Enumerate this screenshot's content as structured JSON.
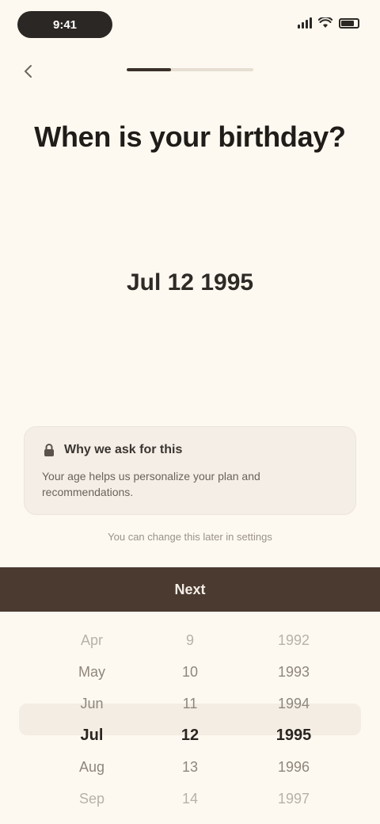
{
  "status_bar": {
    "time": "9:41"
  },
  "progress": {
    "fraction": 0.35
  },
  "question": {
    "title": "When is your birthday?"
  },
  "selected_date": "Jul 12 1995",
  "info_card": {
    "title": "Why we ask for this",
    "body": "Your age helps us personalize your plan and recommendations."
  },
  "hint": "You can change this later in settings",
  "next_button": {
    "label": "Next"
  },
  "picker": {
    "months": [
      "Apr",
      "May",
      "Jun",
      "Jul",
      "Aug",
      "Sep"
    ],
    "days": [
      "9",
      "10",
      "11",
      "12",
      "13",
      "14"
    ],
    "years": [
      "1992",
      "1993",
      "1994",
      "1995",
      "1996",
      "1997"
    ]
  },
  "colors": {
    "background": "#fdf9f0",
    "primary_button": "#4a3a30",
    "text_dark": "#1f1c19"
  }
}
